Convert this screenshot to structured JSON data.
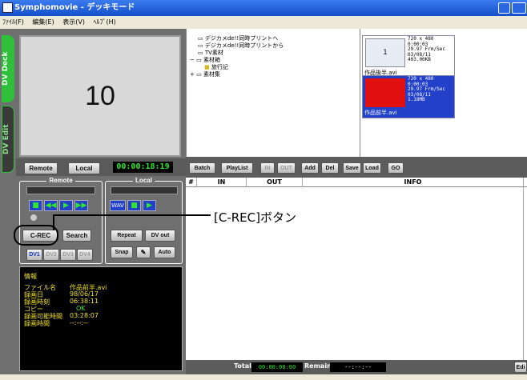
{
  "window": {
    "title": "Symphomovie - デッキモード"
  },
  "menu": [
    "ﾌｧｲﾙ(F)",
    "編集(E)",
    "表示(V)",
    "ﾍﾙﾌﾟ(H)"
  ],
  "side_tabs": {
    "deck": "DV Deck",
    "edit": "DV Edit"
  },
  "monitor": {
    "number": "10"
  },
  "transport": {
    "remote": "Remote",
    "local": "Local",
    "timecode": "00:00:18:19"
  },
  "remote_group": {
    "label": "Remote",
    "play_symbol": "▶",
    "rew_symbol": "◀◀",
    "ff_symbol": "▶▶",
    "stop_symbol": "■"
  },
  "local_group": {
    "label": "Local",
    "wav": "WAV",
    "stop_symbol": "■",
    "play_symbol": "▶"
  },
  "buttons": {
    "crec": "C-REC",
    "search": "Search",
    "repeat": "Repeat",
    "dv_out": "DV out",
    "snap": "Snap",
    "tool_symbol": "✎",
    "auto": "Auto",
    "dv1": "DV1",
    "dv2": "DV2",
    "dv3": "DV3",
    "dv4": "DV4"
  },
  "info": {
    "heading": "情報",
    "rows": [
      {
        "label": "ファイル名",
        "value": "作品前半.avi"
      },
      {
        "label": "録画日",
        "value": "98/06/17"
      },
      {
        "label": "録画時刻",
        "value": "06:38:11"
      },
      {
        "label": "コピー",
        "value": "OK"
      },
      {
        "label": "録画可能時間",
        "value": "03:28:07"
      },
      {
        "label": "録画時間",
        "value": "--:--:--"
      }
    ]
  },
  "tree": [
    {
      "label": "デジカメde!!同時プリントへ",
      "indent": 0
    },
    {
      "label": "デジカメde!!同時プリントから",
      "indent": 0
    },
    {
      "label": "TV素材",
      "indent": 0
    },
    {
      "label": "素材箱",
      "indent": 0,
      "expander": "−"
    },
    {
      "label": "旅行記",
      "indent": 1
    },
    {
      "label": "素材集",
      "indent": 0,
      "expander": "+"
    }
  ],
  "thumbs": [
    {
      "index": "1",
      "info": "720 x 480\n0:00:03\n29.97 Frm/Sec\n03/08/11\n403.00KB",
      "name": "作品後半.avi",
      "selected": false
    },
    {
      "index": "",
      "info": "720 x 480\n0:00:03\n29.97 Frm/Sec\n03/08/11\n1.18MB",
      "name": "作品前半.avi",
      "selected": true
    }
  ],
  "batch_bar": {
    "batch": "Batch",
    "playlist": "PlayList",
    "in": "IN",
    "out": "OUT",
    "add": "Add",
    "del": "Del",
    "save": "Save",
    "load": "Load",
    "go": "GO"
  },
  "list_columns": {
    "num": "#",
    "in": "IN",
    "out": "OUT",
    "info": "INFO"
  },
  "totals": {
    "total_label": "Total",
    "total_value": "00:00:00:00",
    "remain_label": "Remain",
    "remain_value": "--:--:--",
    "edit": "Edi"
  },
  "callout": {
    "text": "[C-REC]ボタン"
  },
  "colors": {
    "accent_blue": "#2340c8",
    "timecode_green": "#2ee62e",
    "info_yellow": "#f0e030",
    "deck_tab_green": "#2fbf3a",
    "selected_thumb_red": "#e01010"
  }
}
